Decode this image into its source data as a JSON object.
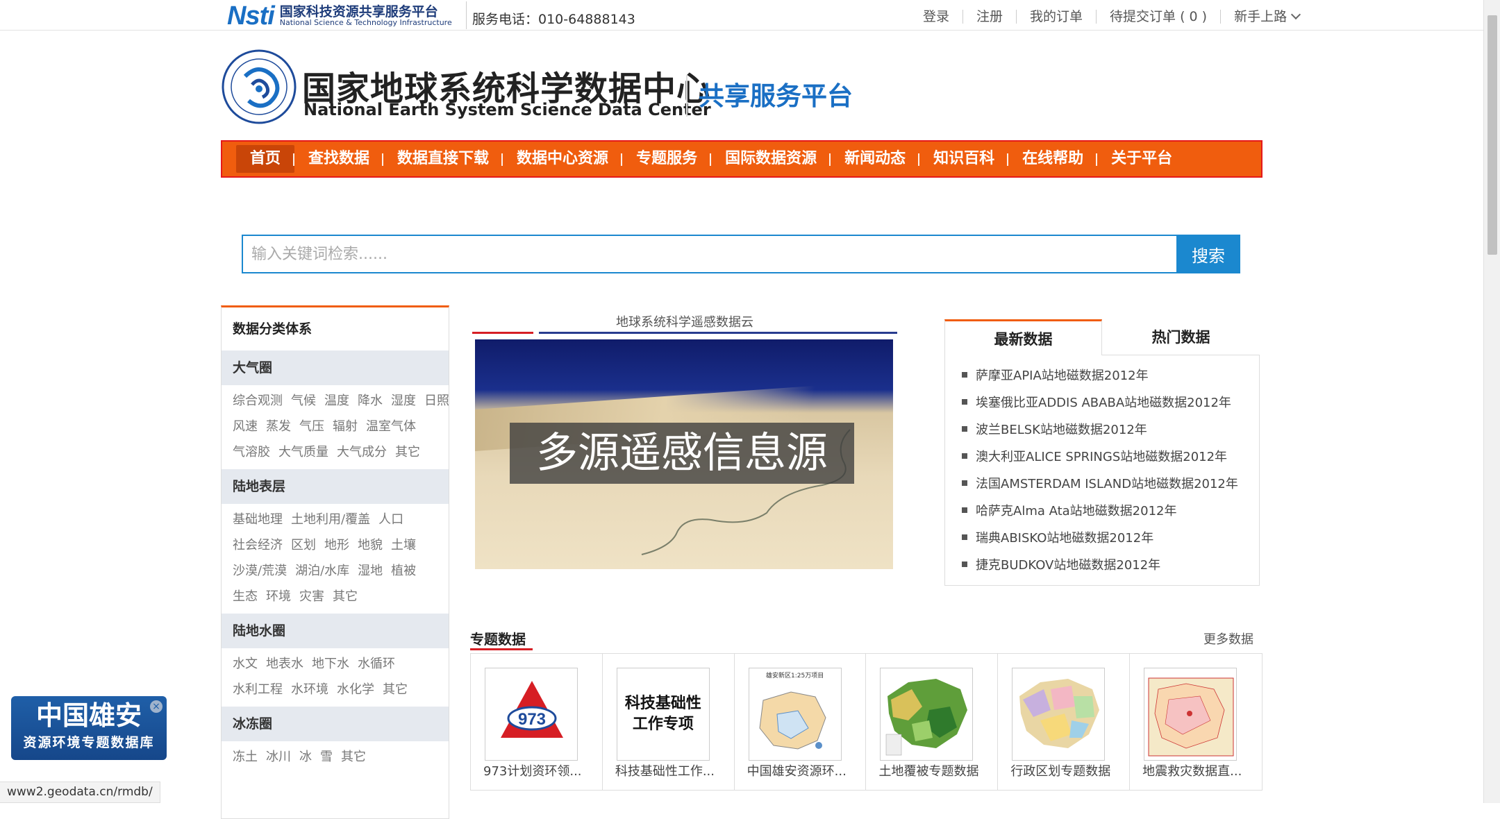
{
  "topbar": {
    "logo_mark": "Nsti",
    "logo_cn": "国家科技资源共享服务平台",
    "logo_en": "National Science & Technology Infrastructure",
    "hotline": "服务电话：010-64888143",
    "links": [
      "登录",
      "注册",
      "我的订单",
      "待提交订单 ( 0 )",
      "新手上路"
    ]
  },
  "header": {
    "title_cn": "国家地球系统科学数据中心",
    "title_en": "National Earth System Science Data Center",
    "share_label": "共享服务平台"
  },
  "nav": [
    "首页",
    "查找数据",
    "数据直接下载",
    "数据中心资源",
    "专题服务",
    "国际数据资源",
    "新闻动态",
    "知识百科",
    "在线帮助",
    "关于平台"
  ],
  "search": {
    "placeholder": "输入关键词检索......",
    "button": "搜索"
  },
  "left_panel": {
    "title": "数据分类体系",
    "sections": [
      {
        "name": "大气圈",
        "rows": [
          [
            "综合观测",
            "气候",
            "温度",
            "降水",
            "湿度",
            "日照"
          ],
          [
            "风速",
            "蒸发",
            "气压",
            "辐射",
            "温室气体"
          ],
          [
            "气溶胶",
            "大气质量",
            "大气成分",
            "其它"
          ]
        ]
      },
      {
        "name": "陆地表层",
        "rows": [
          [
            "基础地理",
            "土地利用/覆盖",
            "人口"
          ],
          [
            "社会经济",
            "区划",
            "地形",
            "地貌",
            "土壤"
          ],
          [
            "沙漠/荒漠",
            "湖泊/水库",
            "湿地",
            "植被"
          ],
          [
            "生态",
            "环境",
            "灾害",
            "其它"
          ]
        ]
      },
      {
        "name": "陆地水圈",
        "rows": [
          [
            "水文",
            "地表水",
            "地下水",
            "水循环"
          ],
          [
            "水利工程",
            "水环境",
            "水化学",
            "其它"
          ]
        ]
      },
      {
        "name": "冰冻圈",
        "rows": [
          [
            "冻土",
            "冰川",
            "冰",
            "雪",
            "其它"
          ]
        ]
      }
    ]
  },
  "carousel": {
    "title": "地球系统科学遥感数据云",
    "caption": "多源遥感信息源"
  },
  "tabs": {
    "active": "最新数据",
    "inactive": "热门数据",
    "items": [
      "萨摩亚APIA站地磁数据2012年",
      "埃塞俄比亚ADDIS ABABA站地磁数据2012年",
      "波兰BELSK站地磁数据2012年",
      "澳大利亚ALICE SPRINGS站地磁数据2012年",
      "法国AMSTERDAM ISLAND站地磁数据2012年",
      "哈萨克Alma Ata站地磁数据2012年",
      "瑞典ABISKO站地磁数据2012年",
      "捷克BUDKOV站地磁数据2012年"
    ]
  },
  "special": {
    "title": "专题数据",
    "more": "更多数据",
    "cards": [
      {
        "label": "973计划资环领...",
        "thumb_text": "973"
      },
      {
        "label": "科技基础性工作...",
        "thumb_text": "科技基础性工作专项"
      },
      {
        "label": "中国雄安资源环...",
        "thumb_text": "雄安新区1:25万项目"
      },
      {
        "label": "土地覆被专题数据",
        "thumb_text": ""
      },
      {
        "label": "行政区划专题数据",
        "thumb_text": ""
      },
      {
        "label": "地震救灾数据直...",
        "thumb_text": ""
      }
    ]
  },
  "float_ad": {
    "line1": "中国雄安",
    "line2": "资源环境专题数据库"
  },
  "status_url": "www2.geodata.cn/rmdb/",
  "colors": {
    "nav_orange": "#f05d0e",
    "accent_blue": "#1b88cf",
    "accent_red": "#d61e24"
  }
}
